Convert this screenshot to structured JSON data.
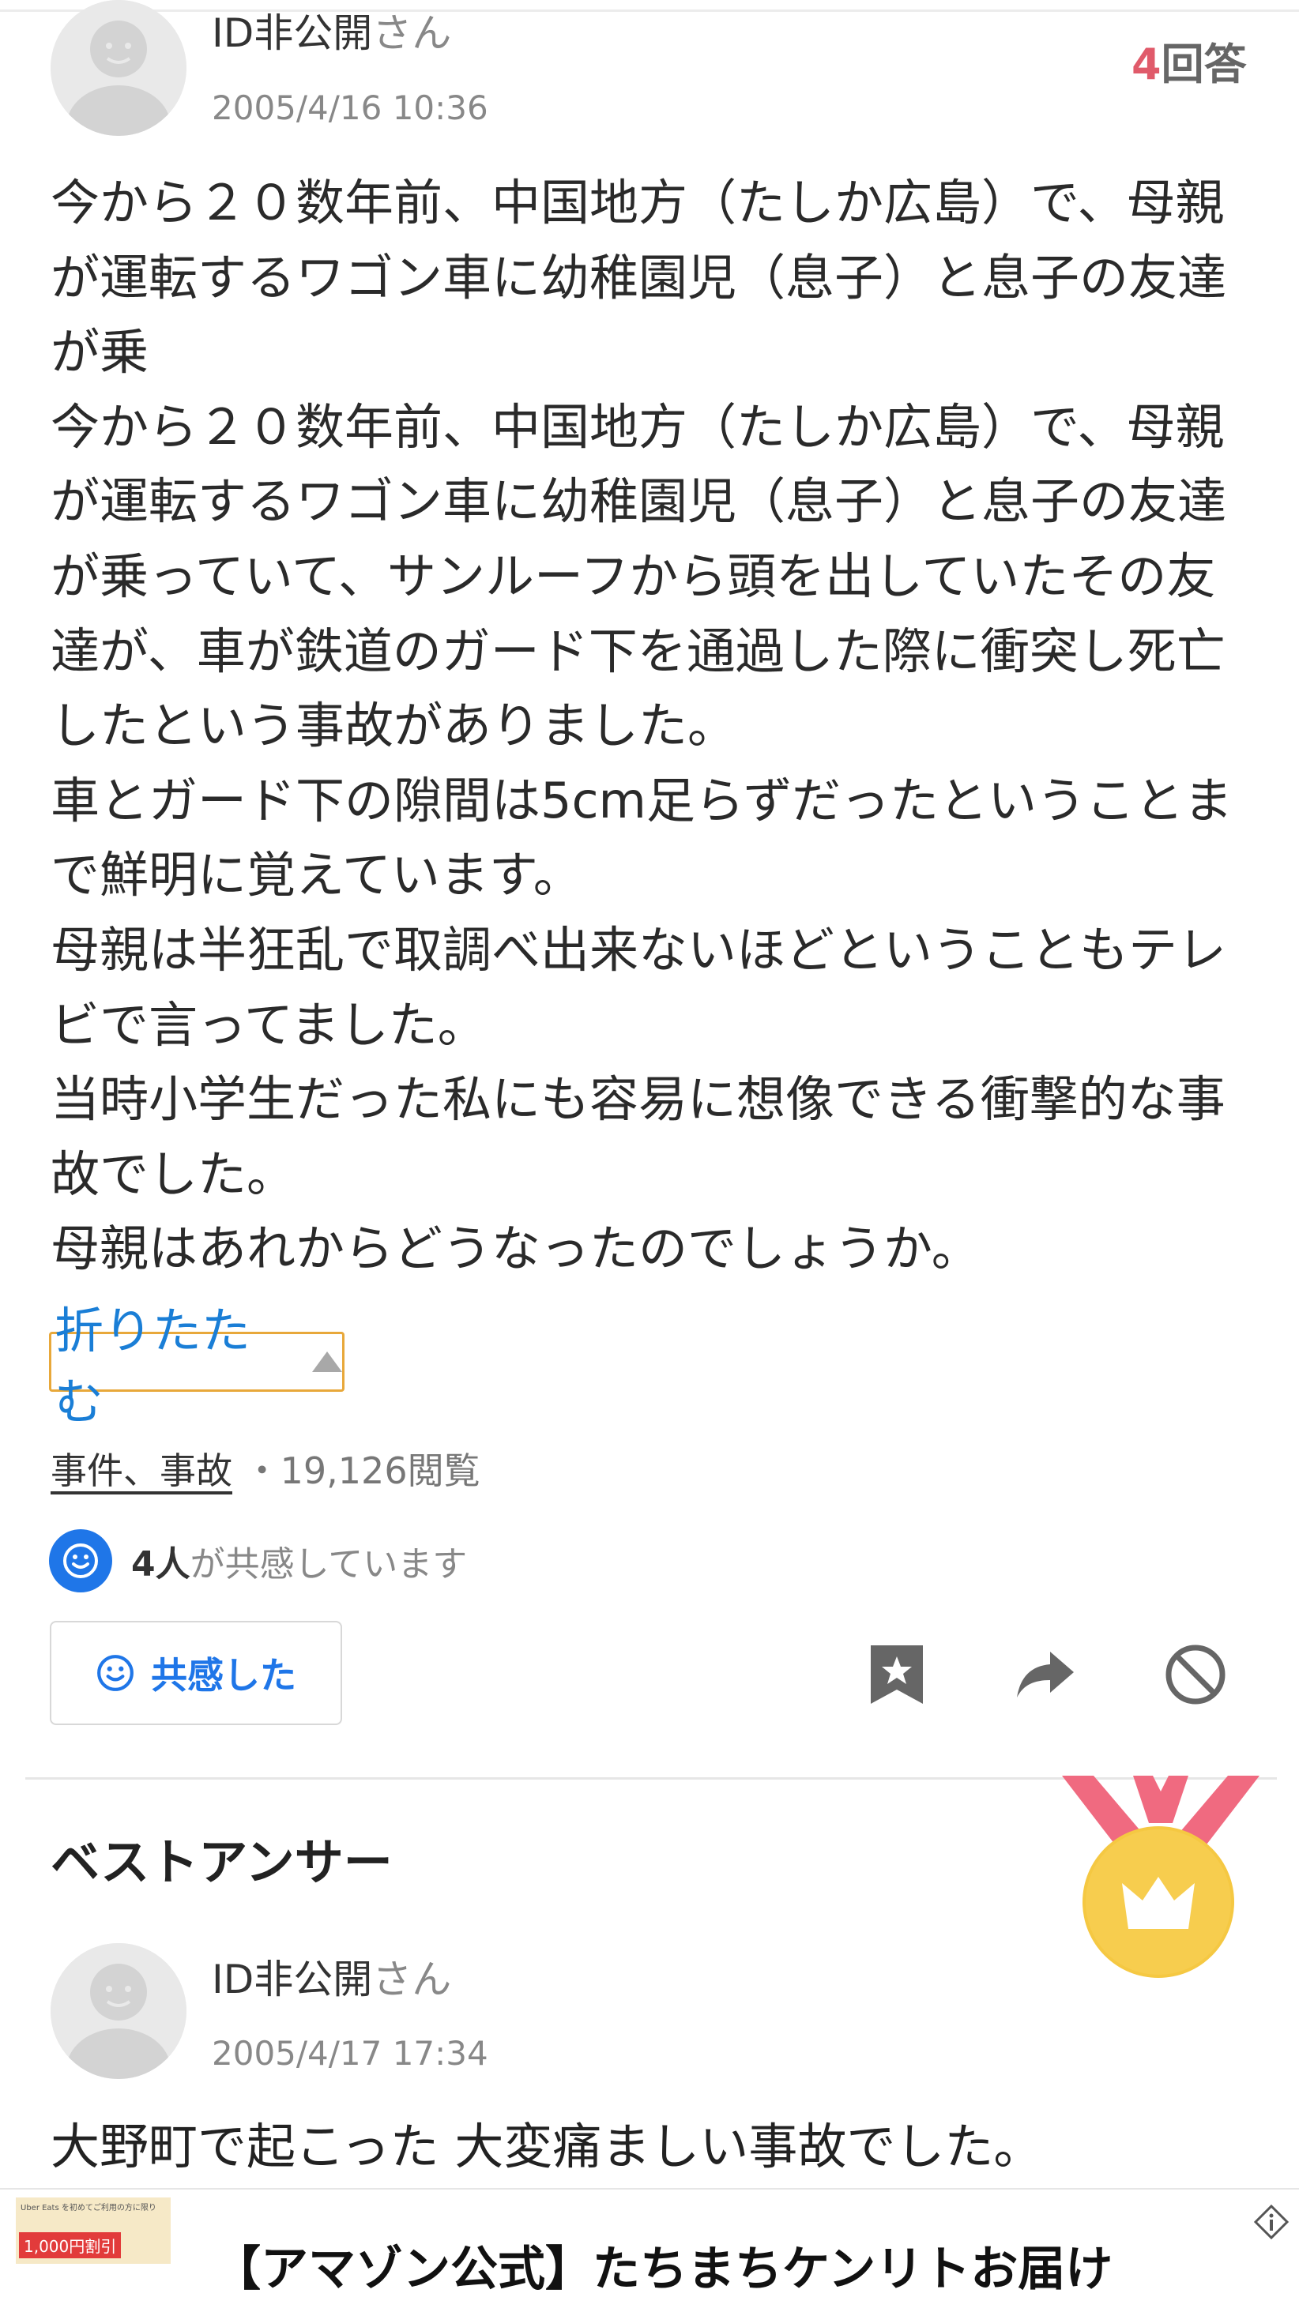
{
  "question": {
    "author": {
      "name": "ID非公開",
      "suffix": "さん",
      "date": "2005/4/16 10:36"
    },
    "answer_count": {
      "number": "4",
      "label": "回答"
    },
    "body_lines": [
      "今から２０数年前、中国地方（たしか広島）で、母親",
      "が運転するワゴン車に幼稚園児（息子）と息子の友達",
      "が乗",
      "今から２０数年前、中国地方（たしか広島）で、母親",
      "が運転するワゴン車に幼稚園児（息子）と息子の友達",
      "が乗っていて、サンルーフから頭を出していたその友",
      "達が、車が鉄道のガード下を通過した際に衝突し死亡",
      "したという事故がありました。",
      "車とガード下の隙間は5cm足らずだったということま",
      "で鮮明に覚えています。",
      "母親は半狂乱で取調べ出来ないほどということもテレ",
      "ビで言ってました。",
      "当時小学生だった私にも容易に想像できる衝撃的な事",
      "故でした。",
      "母親はあれからどうなったのでしょうか。"
    ],
    "collapse_label": "折りたたむ",
    "category": "事件、事故",
    "separator": "・",
    "views": "19,126閲覧",
    "empathy": {
      "count": "4人",
      "text": "が共感しています"
    },
    "empathy_button_label": "共感した",
    "icons": {
      "bookmark": "bookmark-star-icon",
      "share": "share-arrow-icon",
      "block": "block-icon"
    }
  },
  "best_answer": {
    "heading": "ベストアンサー",
    "author": {
      "name": "ID非公開",
      "suffix": "さん",
      "date": "2005/4/17 17:34"
    },
    "text": "大野町で起こった 大変痛ましい事故でした。"
  },
  "ad": {
    "title": "【アマゾン公式】たちまちケンリトお届け",
    "thumb_badge": "1,000円割引",
    "thumb_caption": "Uber Eats を初めてご利用の方に限り"
  },
  "colors": {
    "accent_blue": "#1f76e8",
    "answer_count_red": "#e05a6a",
    "focus_orange": "#e8a83a",
    "medal_gold": "#f5c842",
    "medal_ribbon": "#f06a80"
  }
}
